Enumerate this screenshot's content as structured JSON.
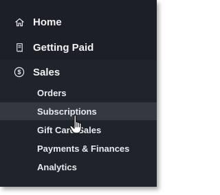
{
  "sidebar": {
    "main_items": [
      {
        "label": "Home",
        "icon": "home-icon"
      },
      {
        "label": "Getting Paid",
        "icon": "receipt-icon"
      },
      {
        "label": "Sales",
        "icon": "dollar-circle-icon"
      }
    ],
    "sub_items": [
      {
        "label": "Orders"
      },
      {
        "label": "Subscriptions"
      },
      {
        "label": "Gift Card Sales"
      },
      {
        "label": "Payments & Finances"
      },
      {
        "label": "Analytics"
      }
    ],
    "selected_sub_item": "Subscriptions"
  },
  "colors": {
    "panel_bg": "#1c1f26",
    "selected_bg": "#343841",
    "text": "#ffffff"
  }
}
